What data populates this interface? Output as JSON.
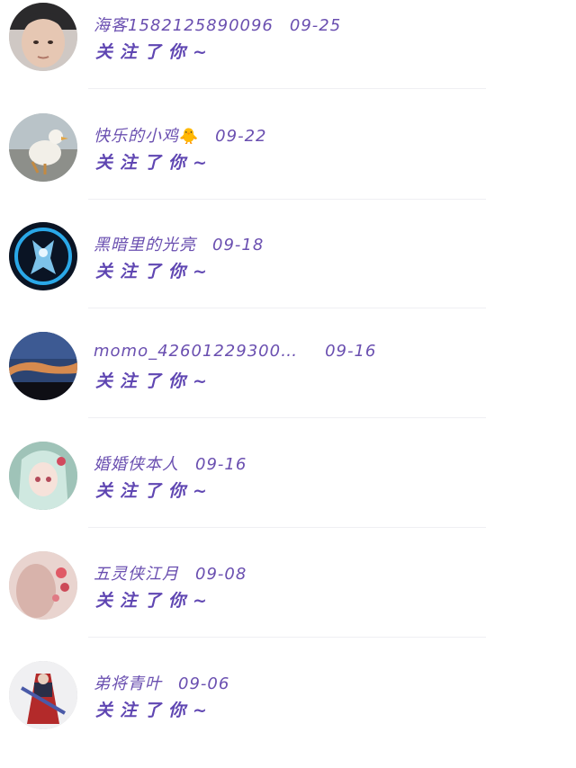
{
  "notifications": [
    {
      "name": "海客1582125890096",
      "date": "09-25",
      "action": "关注了你~",
      "emoji": ""
    },
    {
      "name": "快乐的小鸡",
      "date": "09-22",
      "action": "关注了你~",
      "emoji": "🐥"
    },
    {
      "name": "黑暗里的光亮",
      "date": "09-18",
      "action": "关注了你~",
      "emoji": ""
    },
    {
      "name": "momo_42601229300…",
      "date": "09-16",
      "action": "关注了你~",
      "emoji": ""
    },
    {
      "name": "婚婚侠本人",
      "date": "09-16",
      "action": "关注了你~",
      "emoji": ""
    },
    {
      "name": "五灵侠江月",
      "date": "09-08",
      "action": "关注了你~",
      "emoji": ""
    },
    {
      "name": "弟将青叶",
      "date": "09-06",
      "action": "关注了你~",
      "emoji": ""
    }
  ],
  "colors": {
    "name_text": "#6a4fb0",
    "action_text": "#5f46b2",
    "divider": "#efeff3"
  }
}
